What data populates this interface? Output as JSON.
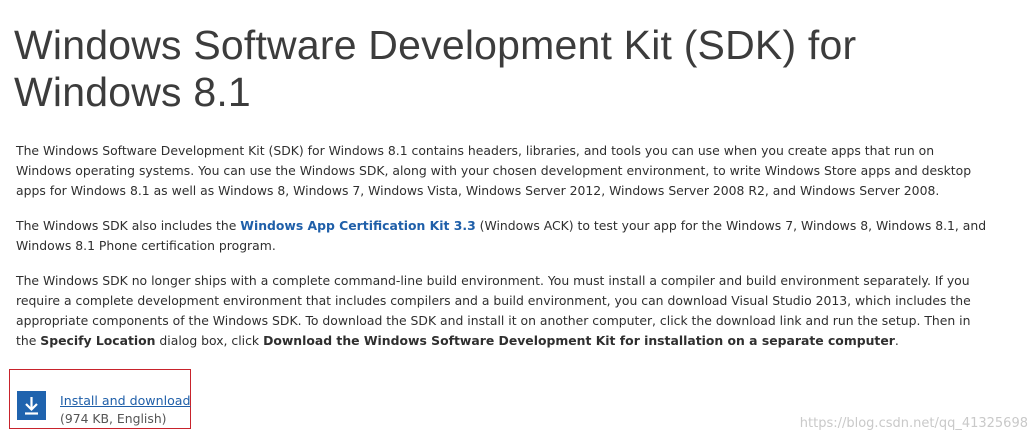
{
  "page": {
    "title": "Windows Software Development Kit (SDK) for Windows 8.1"
  },
  "content": {
    "p1": "The Windows Software Development Kit (SDK) for Windows 8.1 contains headers, libraries, and tools you can use when you create apps that run on Windows operating systems. You can use the Windows SDK, along with your chosen development environment, to write Windows Store apps and desktop apps for Windows 8.1 as well as Windows 8, Windows 7, Windows Vista, Windows Server 2012, Windows Server 2008 R2, and Windows Server 2008.",
    "p2_before": "The Windows SDK also includes the ",
    "p2_link": "Windows App Certification Kit 3.3",
    "p2_after": " (Windows ACK) to test your app for the Windows 7, Windows 8, Windows 8.1, and Windows 8.1 Phone certification program.",
    "p3_part1": "The Windows SDK no longer ships with a complete command-line build environment. You must install a compiler and build environment separately. If you require a complete development environment that includes compilers and a build environment, you can download Visual Studio 2013, which includes the appropriate components of the Windows SDK. To download the SDK and install it on another computer, click the download link and run the setup. Then in the ",
    "p3_bold1": "Specify Location",
    "p3_part2": " dialog box, click ",
    "p3_bold2": "Download the Windows Software Development Kit for installation on a separate computer",
    "p3_part3": "."
  },
  "download": {
    "icon": "download-icon",
    "label": "Install and download",
    "meta": "(974 KB, English)",
    "icon_bg": "#1f63ae",
    "label_color": "#1f5fa9",
    "highlight_border": "#c8232c"
  },
  "watermark": {
    "text": "https://blog.csdn.net/qq_41325698"
  }
}
